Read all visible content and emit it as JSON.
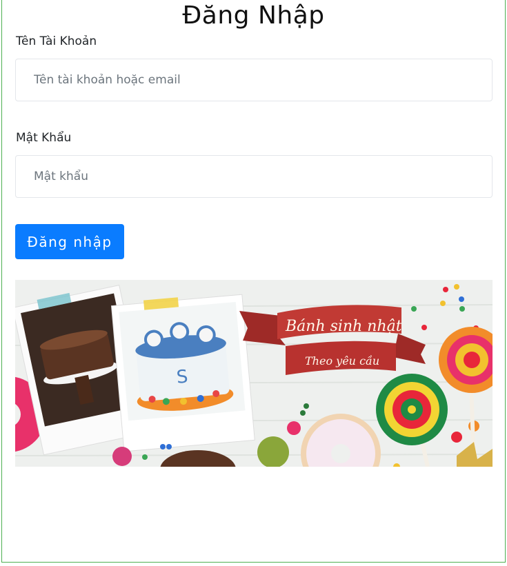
{
  "page": {
    "title": "Đăng Nhập"
  },
  "form": {
    "username_label": "Tên Tài Khoản",
    "username_placeholder": "Tên tài khoản hoặc email",
    "username_value": "",
    "password_label": "Mật Khẩu",
    "password_placeholder": "Mật khẩu",
    "password_value": "",
    "submit_label": "Đăng nhập"
  },
  "banner": {
    "ribbon_line1": "Bánh sinh nhật",
    "ribbon_line2": "Theo yêu cầu"
  },
  "colors": {
    "primary": "#0a7cff",
    "frame_border": "#4caf50",
    "ribbon": "#b8322f"
  }
}
